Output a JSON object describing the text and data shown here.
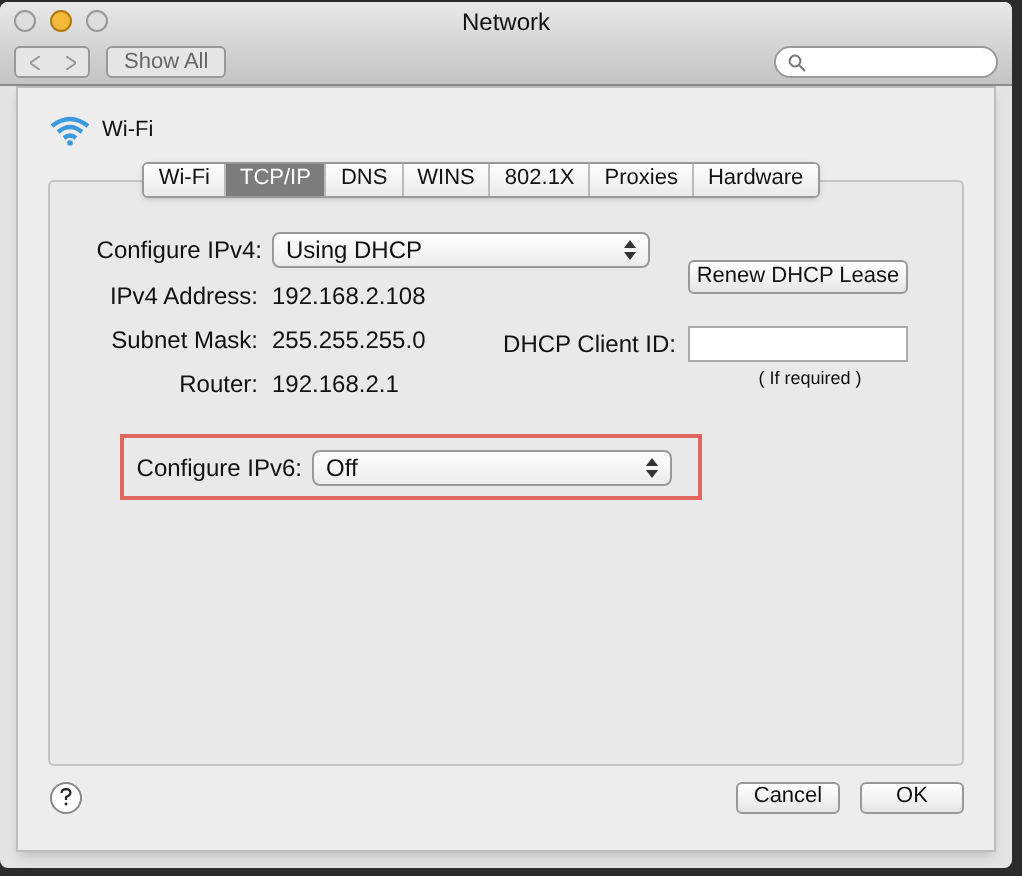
{
  "window": {
    "title": "Network"
  },
  "toolbar": {
    "show_all": "Show All"
  },
  "interface": {
    "name": "Wi-Fi"
  },
  "tabs": [
    {
      "label": "Wi-Fi",
      "selected": false
    },
    {
      "label": "TCP/IP",
      "selected": true
    },
    {
      "label": "DNS",
      "selected": false
    },
    {
      "label": "WINS",
      "selected": false
    },
    {
      "label": "802.1X",
      "selected": false
    },
    {
      "label": "Proxies",
      "selected": false
    },
    {
      "label": "Hardware",
      "selected": false
    }
  ],
  "ipv4": {
    "label": "Configure IPv4:",
    "value": "Using DHCP"
  },
  "fields": [
    {
      "label": "IPv4 Address:",
      "value": "192.168.2.108"
    },
    {
      "label": "Subnet Mask:",
      "value": "255.255.255.0"
    },
    {
      "label": "Router:",
      "value": "192.168.2.1"
    }
  ],
  "renew_button": "Renew DHCP Lease",
  "dhcp_client_id": {
    "label": "DHCP Client ID:",
    "hint": "( If required )"
  },
  "ipv6": {
    "label": "Configure IPv6:",
    "value": "Off",
    "highlighted": true
  },
  "buttons": [
    "Cancel",
    "OK"
  ]
}
